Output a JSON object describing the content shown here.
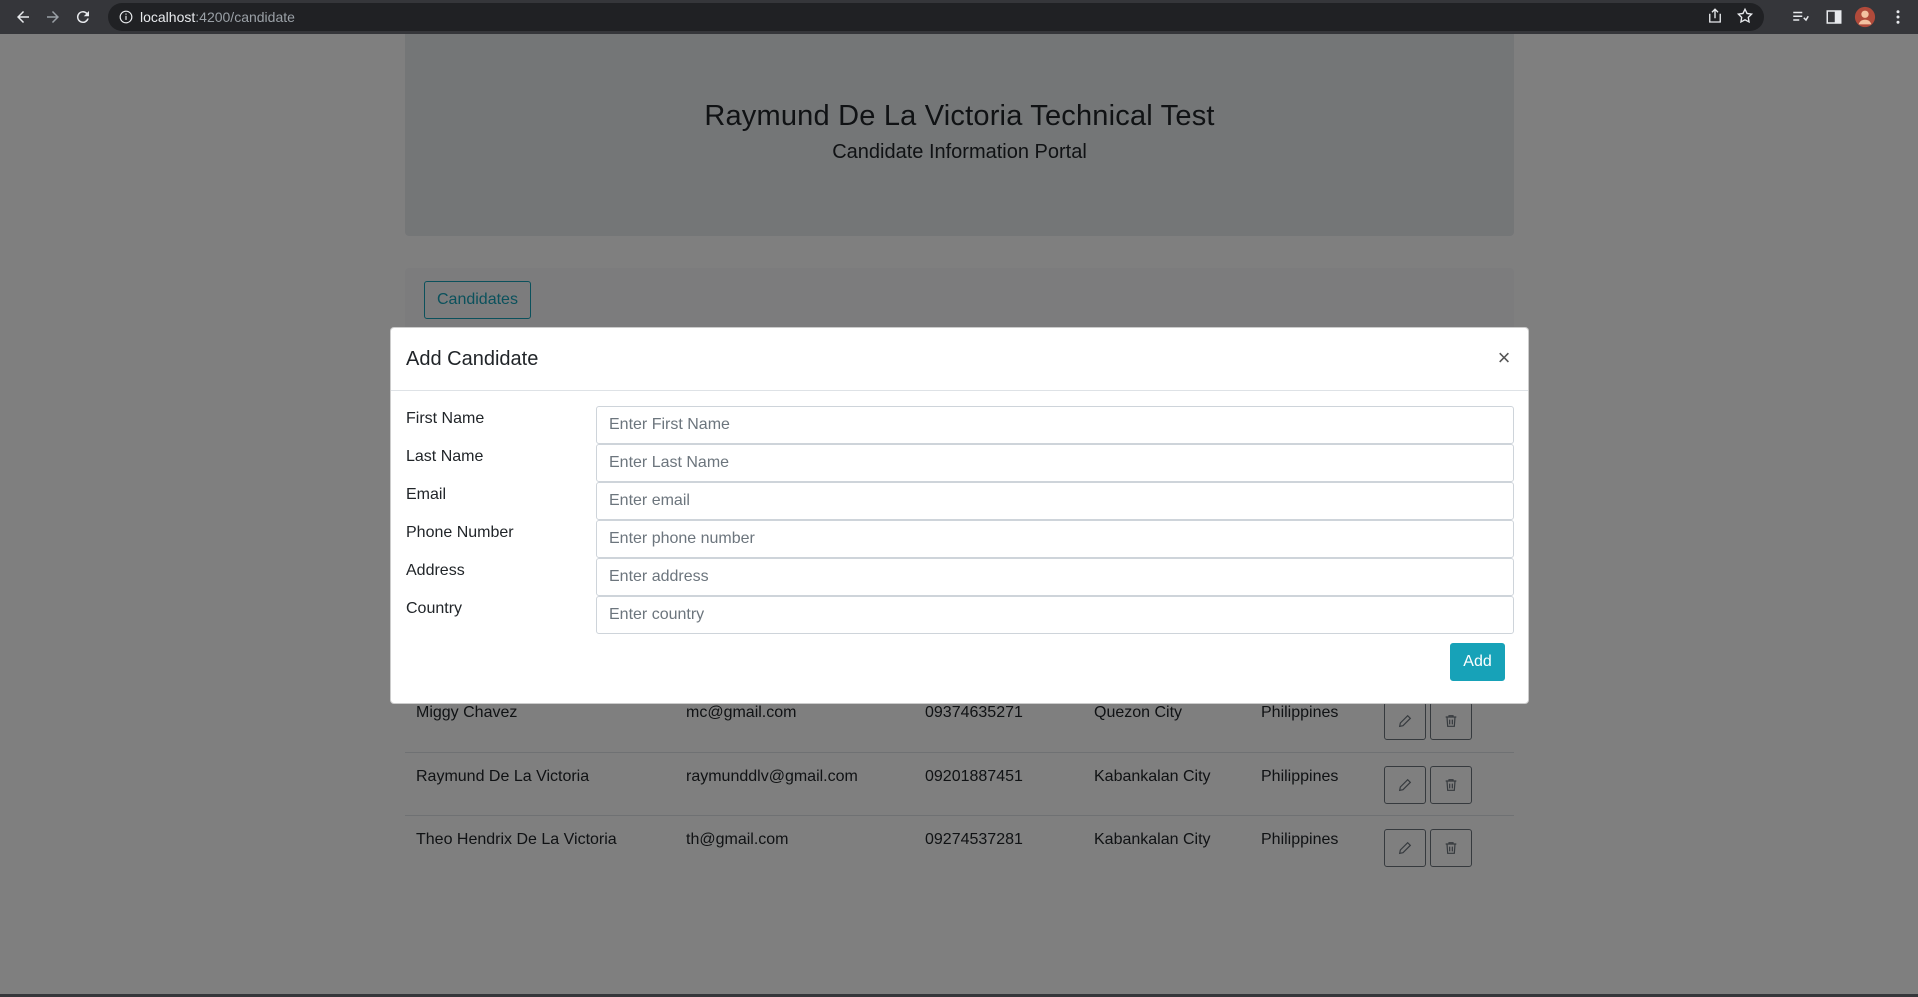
{
  "browser": {
    "url_host": "localhost",
    "url_path": ":4200/candidate"
  },
  "header": {
    "title": "Raymund De La Victoria Technical Test",
    "subtitle": "Candidate Information Portal"
  },
  "tabs": {
    "candidates_label": "Candidates"
  },
  "table": {
    "rows": [
      {
        "name": "Miggy Chavez",
        "email": "mc@gmail.com",
        "phone": "09374635271",
        "address": "Quezon City",
        "country": "Philippines"
      },
      {
        "name": "Raymund De La Victoria",
        "email": "raymunddlv@gmail.com",
        "phone": "09201887451",
        "address": "Kabankalan City",
        "country": "Philippines"
      },
      {
        "name": "Theo Hendrix De La Victoria",
        "email": "th@gmail.com",
        "phone": "09274537281",
        "address": "Kabankalan City",
        "country": "Philippines"
      }
    ]
  },
  "modal": {
    "title": "Add Candidate",
    "close_glyph": "×",
    "fields": [
      {
        "label": "First Name",
        "placeholder": "Enter First Name",
        "value": ""
      },
      {
        "label": "Last Name",
        "placeholder": "Enter Last Name",
        "value": ""
      },
      {
        "label": "Email",
        "placeholder": "Enter email",
        "value": ""
      },
      {
        "label": "Phone Number",
        "placeholder": "Enter phone number",
        "value": ""
      },
      {
        "label": "Address",
        "placeholder": "Enter address",
        "value": ""
      },
      {
        "label": "Country",
        "placeholder": "Enter country",
        "value": ""
      }
    ],
    "add_label": "Add"
  },
  "colors": {
    "accent": "#17a2b8",
    "jumbotron": "#e9ecef",
    "chrome": "#35363a"
  },
  "icons": {
    "back": "arrow-left-icon",
    "forward": "arrow-right-icon",
    "reload": "reload-icon",
    "info": "info-icon",
    "share": "share-icon",
    "bookmark": "star-icon",
    "reading_list": "reading-list-icon",
    "side_panel": "side-panel-icon",
    "profile": "avatar",
    "menu": "kebab-menu-icon",
    "edit": "pencil-icon",
    "delete": "trash-icon"
  }
}
